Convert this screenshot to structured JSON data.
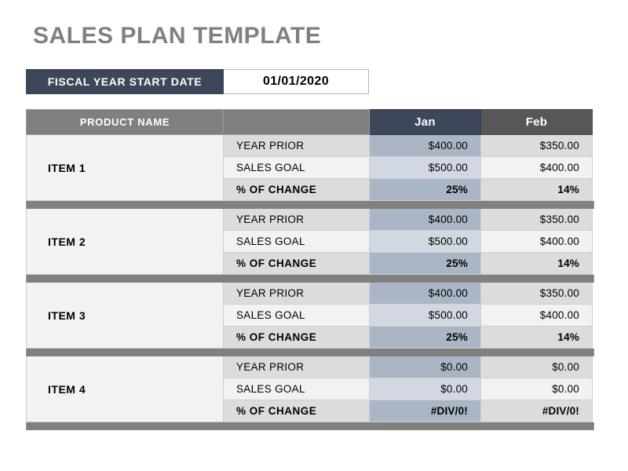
{
  "title": "SALES PLAN TEMPLATE",
  "fiscal": {
    "label": "FISCAL YEAR START DATE",
    "value": "01/01/2020"
  },
  "colors": {
    "title_gray": "#808080",
    "navy": "#3d4759",
    "header_gray": "#808080",
    "feb_header_gray": "#575757",
    "jan_tint_dark": "#aab6c6",
    "jan_tint_light": "#d2d8e2",
    "row_gray": "#dcdcdc",
    "row_white": "#f2f2f2",
    "separator_gray": "#808080"
  },
  "table": {
    "headers": {
      "product_name": "PRODUCT NAME",
      "metric": "",
      "jan": "Jan",
      "feb": "Feb"
    },
    "metric_labels": {
      "year_prior": "YEAR PRIOR",
      "sales_goal": "SALES GOAL",
      "pct_change": "% OF CHANGE"
    },
    "items": [
      {
        "name": "ITEM 1",
        "year_prior": {
          "jan": "$400.00",
          "feb": "$350.00"
        },
        "sales_goal": {
          "jan": "$500.00",
          "feb": "$400.00"
        },
        "pct_change": {
          "jan": "25%",
          "feb": "14%"
        }
      },
      {
        "name": "ITEM 2",
        "year_prior": {
          "jan": "$400.00",
          "feb": "$350.00"
        },
        "sales_goal": {
          "jan": "$500.00",
          "feb": "$400.00"
        },
        "pct_change": {
          "jan": "25%",
          "feb": "14%"
        }
      },
      {
        "name": "ITEM 3",
        "year_prior": {
          "jan": "$400.00",
          "feb": "$350.00"
        },
        "sales_goal": {
          "jan": "$500.00",
          "feb": "$400.00"
        },
        "pct_change": {
          "jan": "25%",
          "feb": "14%"
        }
      },
      {
        "name": "ITEM 4",
        "year_prior": {
          "jan": "$0.00",
          "feb": "$0.00"
        },
        "sales_goal": {
          "jan": "$0.00",
          "feb": "$0.00"
        },
        "pct_change": {
          "jan": "#DIV/0!",
          "feb": "#DIV/0!"
        }
      }
    ]
  }
}
